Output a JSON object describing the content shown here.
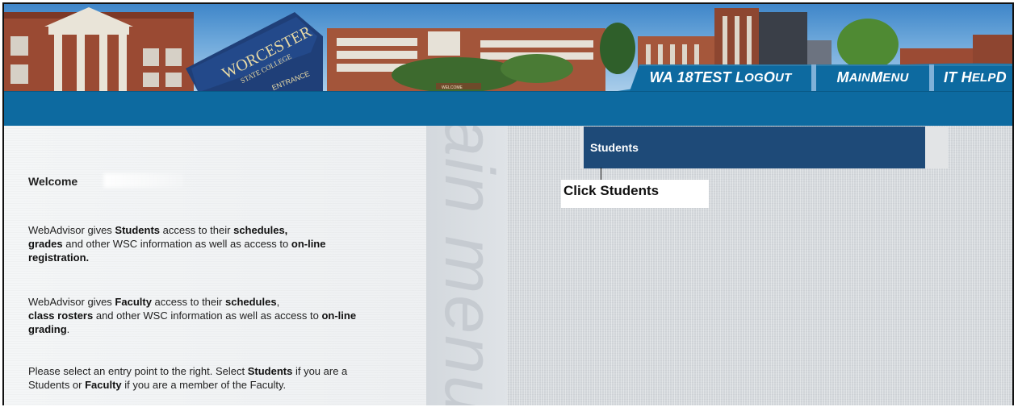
{
  "nav": {
    "user_part1": "WA 18TEST L",
    "user_part2": "OG",
    "user_part3": "O",
    "user_part4": "UT",
    "main_part1": "M",
    "main_part2": "AIN ",
    "main_part3": "M",
    "main_part4": "ENU",
    "help_part1": "IT H",
    "help_part2": "ELP ",
    "help_part3": "D"
  },
  "banner": {
    "sign_text": "WORCESTER",
    "sign_sub": "STATE COLLEGE",
    "sign_entrance": "ENTRANCE",
    "welcome_sign": "WELCOME"
  },
  "watermark": "ain menu",
  "menu": {
    "students_label": "Students"
  },
  "callout": {
    "text": "Click Students"
  },
  "content": {
    "welcome": "Welcome",
    "p1": [
      "WebAdvisor gives ",
      "Students",
      " access to their ",
      "schedules,",
      "grades",
      " and other WSC information as well as access to ",
      "on-line registration."
    ],
    "p2": [
      "WebAdvisor gives ",
      "Faculty",
      " access to their ",
      "schedules",
      ",",
      "class rosters",
      " and other WSC information as well as access to ",
      "on-line grading",
      "."
    ],
    "p3": [
      "Please select an entry point to the right. Select ",
      "Students",
      " if you are a Students or ",
      "Faculty",
      " if you are a member of the Faculty."
    ]
  }
}
